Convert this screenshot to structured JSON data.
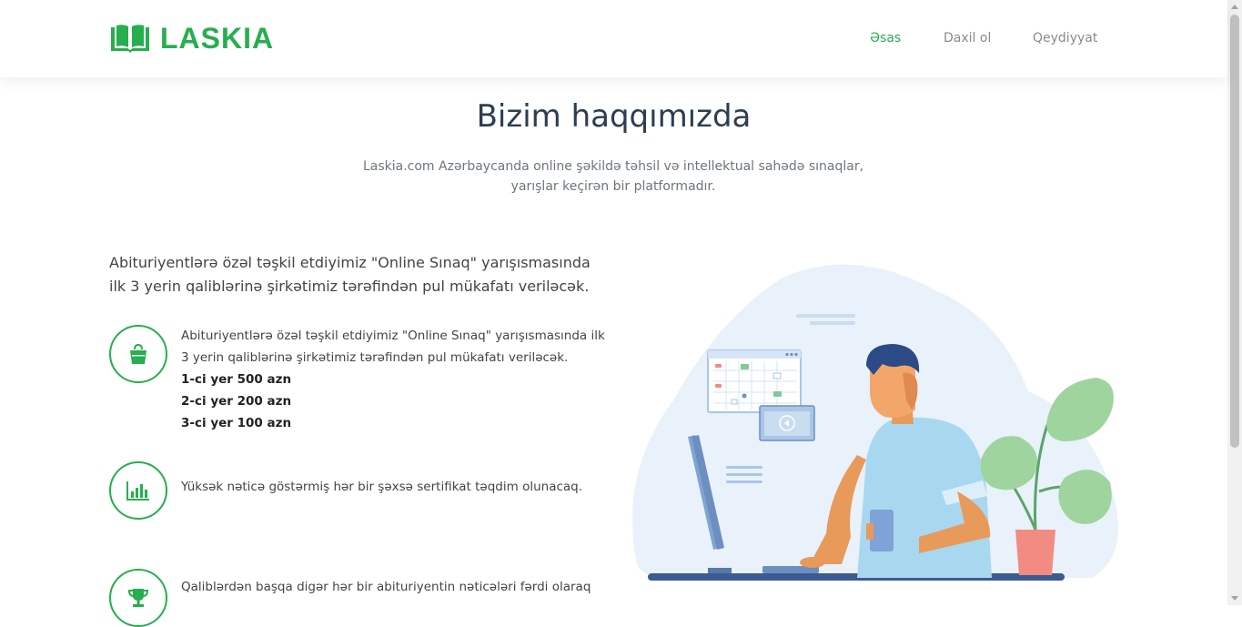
{
  "header": {
    "logo_text": "LASKIA",
    "nav": [
      {
        "label": "Əsas",
        "active": true
      },
      {
        "label": "Daxil ol",
        "active": false
      },
      {
        "label": "Qeydiyyat",
        "active": false
      }
    ]
  },
  "main": {
    "title": "Bizim haqqımızda",
    "intro_line1": "Laskia.com Azərbaycanda online şəkildə təhsil və intellektual sahədə sınaqlar,",
    "intro_line2": "yarışlar keçirən bir platformadır.",
    "lead": "Abituriyentlərə özəl təşkil etdiyimiz \"Online Sınaq\" yarışısmasında ilk 3 yerin qaliblərinə şirkətimiz tərəfindən pul mükafatı veriləcək.",
    "features": [
      {
        "icon": "shopping-bag-icon",
        "text": "Abituriyentlərə özəl təşkil etdiyimiz \"Online Sınaq\" yarışısmasında ilk 3 yerin qaliblərinə şirkətimiz tərəfindən pul mükafatı veriləcək.",
        "prizes": [
          "1-ci yer 500 azn",
          "2-ci yer 200 azn",
          "3-ci yer 100 azn"
        ]
      },
      {
        "icon": "bar-chart-icon",
        "text": "Yüksək nəticə göstərmiş hər bir şəxsə sertifikat təqdim olunacaq."
      },
      {
        "icon": "trophy-icon",
        "text": "Qaliblərdən başqa digər hər bir abituriyentin nəticələri fərdi olaraq"
      }
    ]
  },
  "colors": {
    "brand_green": "#27ae4f",
    "title": "#2c3e50",
    "muted": "#6c757d"
  }
}
